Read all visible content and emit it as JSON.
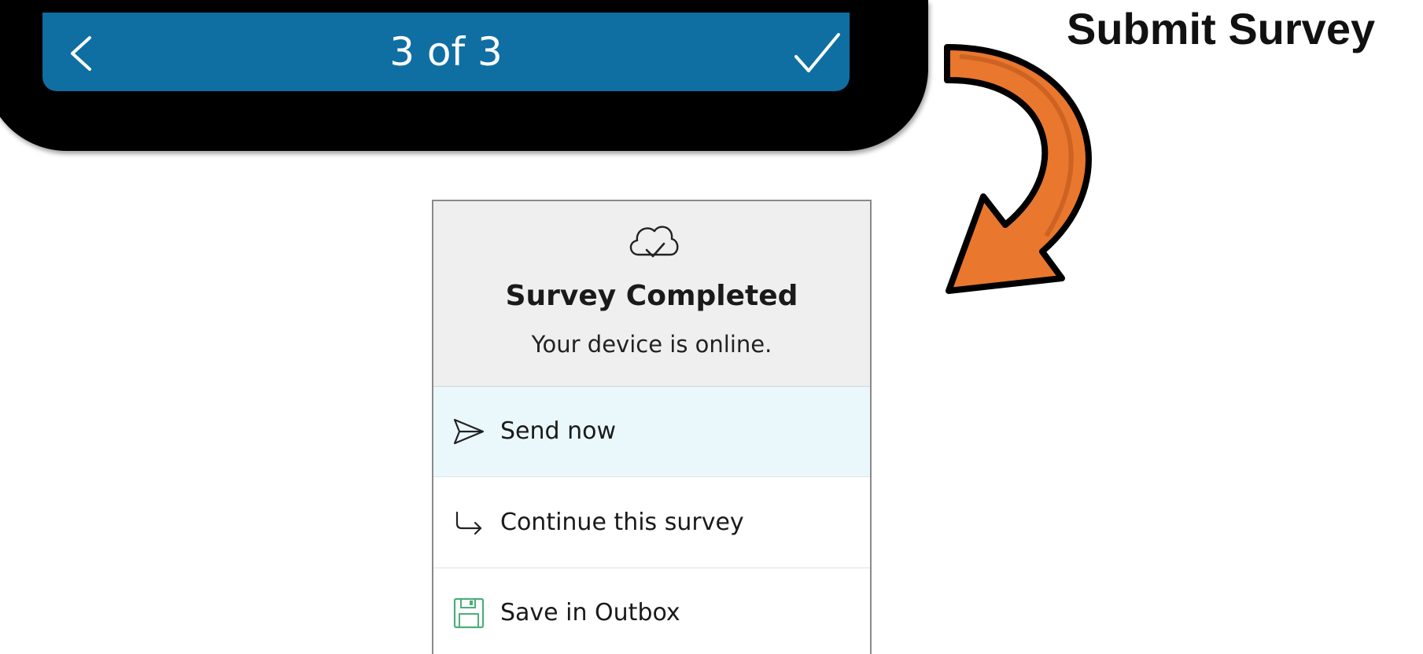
{
  "phone_nav": {
    "counter": "3 of 3",
    "back_icon": "chevron-left-icon",
    "submit_icon": "checkmark-icon",
    "bar_color": "#0f6fa3"
  },
  "annotation": {
    "title": "Submit Survey",
    "arrow_color": "#e9772e"
  },
  "dialog": {
    "icon": "cloud-check-icon",
    "title": "Survey Completed",
    "subtitle": "Your device is online.",
    "options": [
      {
        "label": "Send now",
        "icon": "paper-plane-icon",
        "selected": true
      },
      {
        "label": "Continue this survey",
        "icon": "return-arrow-icon",
        "selected": false
      },
      {
        "label": "Save in Outbox",
        "icon": "floppy-disk-icon",
        "selected": false
      }
    ],
    "selected_bg": "#eaf8fc",
    "save_icon_color": "#4cae7a"
  }
}
